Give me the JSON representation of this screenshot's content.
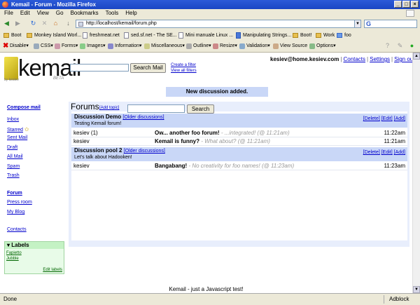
{
  "window": {
    "title": "Kemail - Forum - Mozilla Firefox"
  },
  "menu": [
    "File",
    "Edit",
    "View",
    "Go",
    "Bookmarks",
    "Tools",
    "Help"
  ],
  "nav": {
    "url": "http://localhost/kemail/forum.php"
  },
  "bookmarks": [
    "Boot",
    "Monkey Island Worl...",
    "freshmeat.net",
    "sed.sf.net - The SE...",
    "Mini manuale Linux ...",
    "Manipulating Strings...",
    "Boot!",
    "Work",
    "foo"
  ],
  "devbar": [
    "Disable▾",
    "CSS▾",
    "Forms▾",
    "Images▾",
    "Information▾",
    "Miscellaneous▾",
    "Outline▾",
    "Resize▾",
    "Validation▾",
    "View Source",
    "Options▾"
  ],
  "header": {
    "logo_text": "kemail",
    "logo_by": "by kesiev",
    "logo_beta": "BETA",
    "search_button": "Search Mail",
    "create_filter": "Create a filter",
    "view_filters": "View all filters",
    "account_email": "kesiev@home.kesiev.com",
    "account_links": [
      "Contacts",
      "Settings",
      "Sign out"
    ]
  },
  "notice": "New discussion added.",
  "sidebar": {
    "compose": "Compose mail",
    "items": [
      "Inbox",
      "Starred",
      "Sent Mail",
      "Draft",
      "All Mail",
      "Spam",
      "Trash"
    ],
    "items2": [
      "Forum",
      "Press room",
      "My Blog"
    ],
    "contacts": "Contacts",
    "labels_title": "Labels",
    "labels": [
      "Fapietto",
      "Jubble"
    ],
    "edit_labels": "Edit labels"
  },
  "forum": {
    "title": "Forums",
    "add_topic": "[Add topic]",
    "older_discussions": "[Older discussions]",
    "search_button": "Search",
    "discussions": [
      {
        "name": "Discussion Demo",
        "older": "[Older discussions]",
        "desc": "Testing Kemail forum!",
        "actions": [
          "[Delete]",
          "[Edit]",
          "[Add]"
        ],
        "threads": [
          {
            "author": "kesiev (1)",
            "subject": "Ow... another foo forum!",
            "snippet": " - ...integrated! (@ 11:21am)",
            "time": "11:22am"
          },
          {
            "author": "kesiev",
            "subject": "Kemail is funny?",
            "snippet": " - What about? (@ 11:21am)",
            "time": "11:21am"
          }
        ]
      },
      {
        "name": "Discussion pool 2",
        "older": "[Older discussions]",
        "desc": "Let's talk about Hadooken!",
        "actions": [
          "[Delete]",
          "[Edit]",
          "[Add]"
        ],
        "threads": [
          {
            "author": "kesiev",
            "subject": "Bangabang!",
            "snippet": " - No creativity for foo names! (@ 11:23am)",
            "time": "11:23am"
          }
        ]
      }
    ]
  },
  "footer": "Kemail - just a Javascript test!",
  "status": {
    "left": "Done",
    "right": "Adblock"
  },
  "colors": {
    "accent_blue": "#c9d7f7",
    "panel_bg": "#e8eefc",
    "labels_green": "#c4f2c4",
    "link": "#0000cc"
  }
}
